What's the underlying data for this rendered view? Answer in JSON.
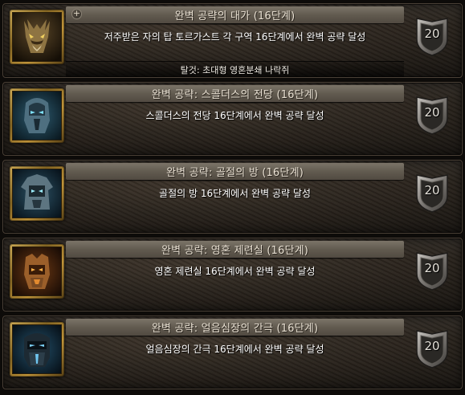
{
  "achievements": [
    {
      "title": "완벽 공략의 대가 (16단계)",
      "description": "저주받은 자의 탑 토르가스트 각 구역 16단계에서 완벽 공략 달성",
      "reward": "탈것: 초대형 영혼분쇄 나락쥐",
      "points": "20",
      "icon": "beast-mount-icon",
      "expanded": true
    },
    {
      "title": "완벽 공략: 스콜더스의 전당 (16단계)",
      "description": "스콜더스의 전당 16단계에서 완벽 공략 달성",
      "points": "20",
      "icon": "skoldus-helm-icon"
    },
    {
      "title": "완벽 공략: 골절의 방 (16단계)",
      "description": "골절의 방 16단계에서 완벽 공략 달성",
      "points": "20",
      "icon": "fracture-helm-icon"
    },
    {
      "title": "완벽 공략: 영혼 제련실 (16단계)",
      "description": "영혼 제련실 16단계에서 완벽 공략 달성",
      "points": "20",
      "icon": "soulforge-helm-icon"
    },
    {
      "title": "완벽 공략: 얼음심장의 간극 (16단계)",
      "description": "얼음심장의 간극 16단계에서 완벽 공략 달성",
      "points": "20",
      "icon": "coldheart-helm-icon"
    }
  ],
  "colors": {
    "title_text": "#e8e0d2",
    "description_text": "#ffffff",
    "icon_frame_gold": "#c89a3c",
    "shield_silver": "#8d8a85"
  }
}
